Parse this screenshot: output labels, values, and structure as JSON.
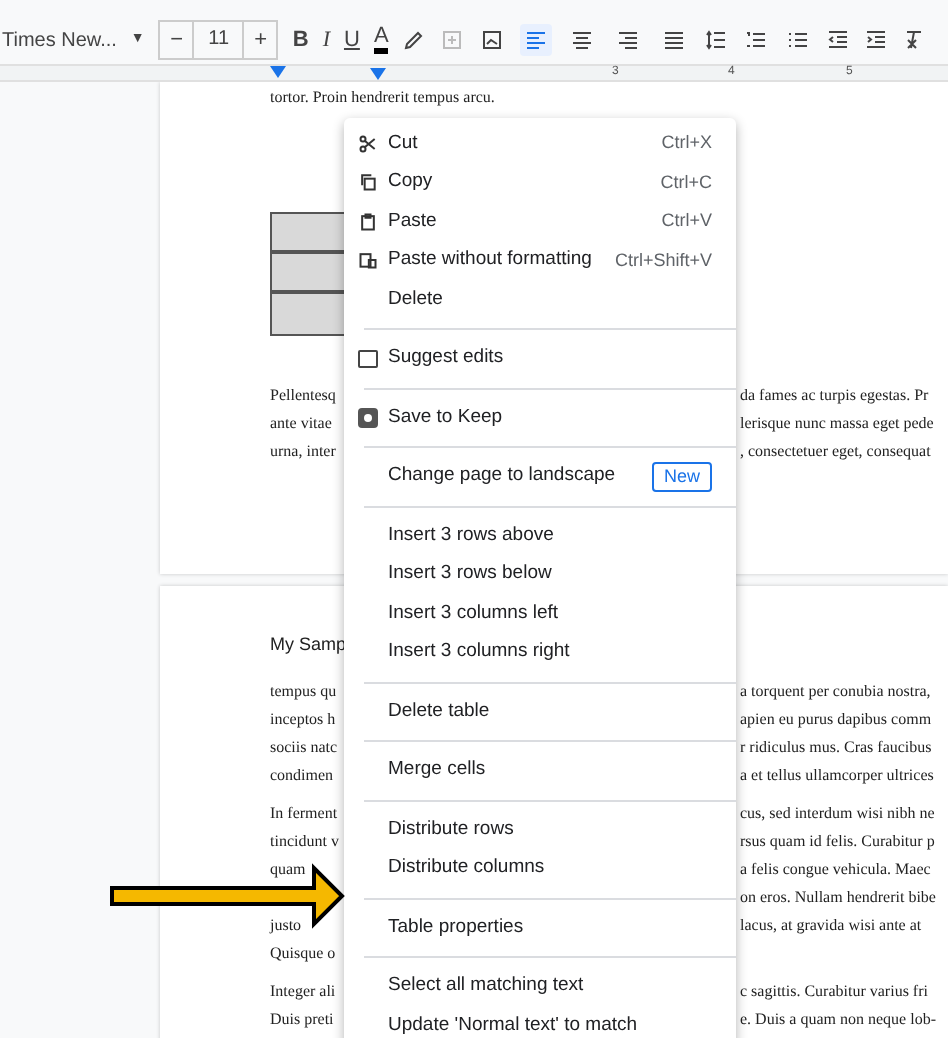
{
  "toolbar": {
    "font": "Times New...",
    "font_caret": "▼",
    "size_minus": "−",
    "font_size": "11",
    "size_plus": "+",
    "bold": "B",
    "italic": "I",
    "underline": "U",
    "text_color": "A",
    "alignment": [
      {
        "selected": true
      },
      {
        "selected": false
      },
      {
        "selected": false
      },
      {
        "selected": false
      }
    ]
  },
  "ruler": {
    "ticks": [
      "3",
      "4",
      "5"
    ]
  },
  "pages": [
    {
      "lines": [
        {
          "left": "tortor. Proin hendrerit tempus arcu."
        },
        {
          "kind": "table"
        },
        {
          "left": "Pellentesq",
          "right": "da fames ac turpis egestas. Pr"
        },
        {
          "left": "ante vitae",
          "right": "lerisque nunc massa eget pede"
        },
        {
          "left": "urna, inter",
          "right": ", consectetuer eget, consequat"
        }
      ]
    },
    {
      "lines": [
        {
          "kind": "heading",
          "left": "My Samp"
        },
        {
          "left": "tempus qu",
          "right": "a torquent per conubia nostra,"
        },
        {
          "left": "inceptos h",
          "right": "apien eu purus dapibus comm"
        },
        {
          "left": "sociis natc",
          "right": "r ridiculus mus. Cras faucibus"
        },
        {
          "left": "condimen",
          "right": "a et tellus ullamcorper ultrices"
        },
        {
          "kind": "gap"
        },
        {
          "left": "In ferment",
          "right": "cus, sed interdum wisi nibh ne"
        },
        {
          "left": "tincidunt v",
          "right": "rsus quam id felis. Curabitur p"
        },
        {
          "left": "quam",
          "right": "a felis congue vehicula. Maec"
        },
        {
          "right": "on eros. Nullam hendrerit bibe"
        },
        {
          "left": "justo",
          "right": "lacus, at gravida wisi ante at"
        },
        {
          "left": "Quisque o"
        },
        {
          "kind": "gap"
        },
        {
          "left": "Integer ali",
          "right": "c sagittis. Curabitur varius fri"
        },
        {
          "left": "Duis preti",
          "right": "e. Duis a quam non neque lob-"
        }
      ]
    }
  ],
  "context_menu": {
    "groups": [
      [
        {
          "label": "Cut",
          "shortcut": "Ctrl+X"
        },
        {
          "label": "Copy",
          "shortcut": "Ctrl+C"
        },
        {
          "label": "Paste",
          "shortcut": "Ctrl+V"
        },
        {
          "label": "Paste without formatting",
          "shortcut": "Ctrl+Shift+V"
        },
        {
          "label": "Delete"
        }
      ],
      [
        {
          "label": "Suggest edits"
        }
      ],
      [
        {
          "label": "Save to Keep"
        }
      ],
      [
        {
          "label": "Change page to landscape",
          "badge": "New"
        }
      ],
      [
        {
          "label": "Insert 3 rows above"
        },
        {
          "label": "Insert 3 rows below"
        },
        {
          "label": "Insert 3 columns left"
        },
        {
          "label": "Insert 3 columns right"
        }
      ],
      [
        {
          "label": "Delete table"
        }
      ],
      [
        {
          "label": "Merge cells"
        }
      ],
      [
        {
          "label": "Distribute rows"
        },
        {
          "label": "Distribute columns"
        }
      ],
      [
        {
          "label": "Table properties"
        }
      ],
      [
        {
          "label": "Select all matching text"
        },
        {
          "label": "Update 'Normal text' to match"
        }
      ]
    ]
  }
}
